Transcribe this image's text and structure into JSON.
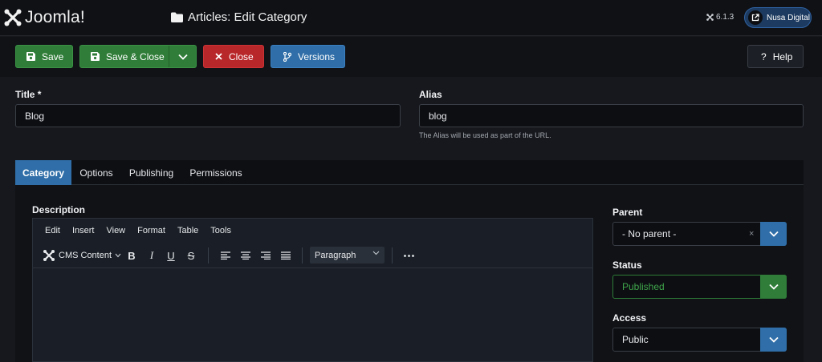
{
  "app": {
    "brand": "Joomla!",
    "version": "6.1.3",
    "user_site": "Nusa Digital"
  },
  "page": {
    "title": "Articles: Edit Category"
  },
  "toolbar": {
    "save": "Save",
    "save_close": "Save & Close",
    "close": "Close",
    "versions": "Versions",
    "help": "Help"
  },
  "form": {
    "title_label": "Title *",
    "title_value": "Blog",
    "alias_label": "Alias",
    "alias_value": "blog",
    "alias_hint": "The Alias will be used as part of the URL."
  },
  "tabs": [
    {
      "label": "Category",
      "active": true
    },
    {
      "label": "Options",
      "active": false
    },
    {
      "label": "Publishing",
      "active": false
    },
    {
      "label": "Permissions",
      "active": false
    }
  ],
  "editor": {
    "label": "Description",
    "menu": [
      "Edit",
      "Insert",
      "View",
      "Format",
      "Table",
      "Tools"
    ],
    "cms_content": "CMS Content",
    "block_format": "Paragraph"
  },
  "sidebar": {
    "parent_label": "Parent",
    "parent_value": "- No parent -",
    "status_label": "Status",
    "status_value": "Published",
    "access_label": "Access",
    "access_value": "Public"
  },
  "colors": {
    "save_green": "#2f7d38",
    "close_red": "#b8272a",
    "accent_blue": "#2f6ea8",
    "status_green": "#3fa44a"
  },
  "icons": [
    "joomla-logo",
    "folder-icon",
    "joomla-small-icon",
    "external-link-icon",
    "save-icon",
    "chevron-down-icon",
    "close-icon",
    "branch-icon",
    "question-icon"
  ]
}
